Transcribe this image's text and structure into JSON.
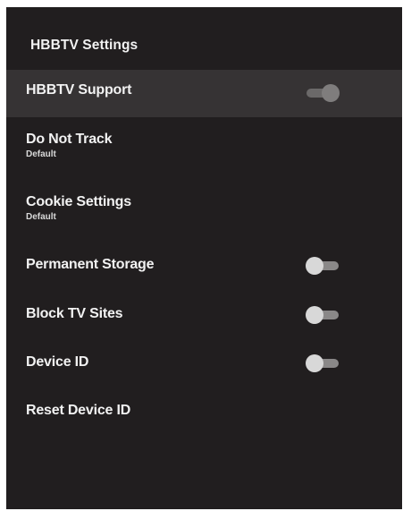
{
  "settings": {
    "title": "HBBTV Settings",
    "items": [
      {
        "label": "HBBTV Support",
        "subtitle": "",
        "toggle": true,
        "toggle_on": true,
        "selected": true
      },
      {
        "label": "Do Not Track",
        "subtitle": "Default",
        "toggle": false,
        "selected": false
      },
      {
        "label": "Cookie Settings",
        "subtitle": "Default",
        "toggle": false,
        "selected": false
      },
      {
        "label": "Permanent Storage",
        "subtitle": "",
        "toggle": true,
        "toggle_on": false,
        "selected": false
      },
      {
        "label": "Block TV Sites",
        "subtitle": "",
        "toggle": true,
        "toggle_on": false,
        "selected": false
      },
      {
        "label": "Device ID",
        "subtitle": "",
        "toggle": true,
        "toggle_on": false,
        "selected": false
      },
      {
        "label": "Reset Device ID",
        "subtitle": "",
        "toggle": false,
        "selected": false
      }
    ]
  },
  "colors": {
    "background": "#211e1f",
    "selected_row": "#363334",
    "text": "#f2f2f2"
  }
}
